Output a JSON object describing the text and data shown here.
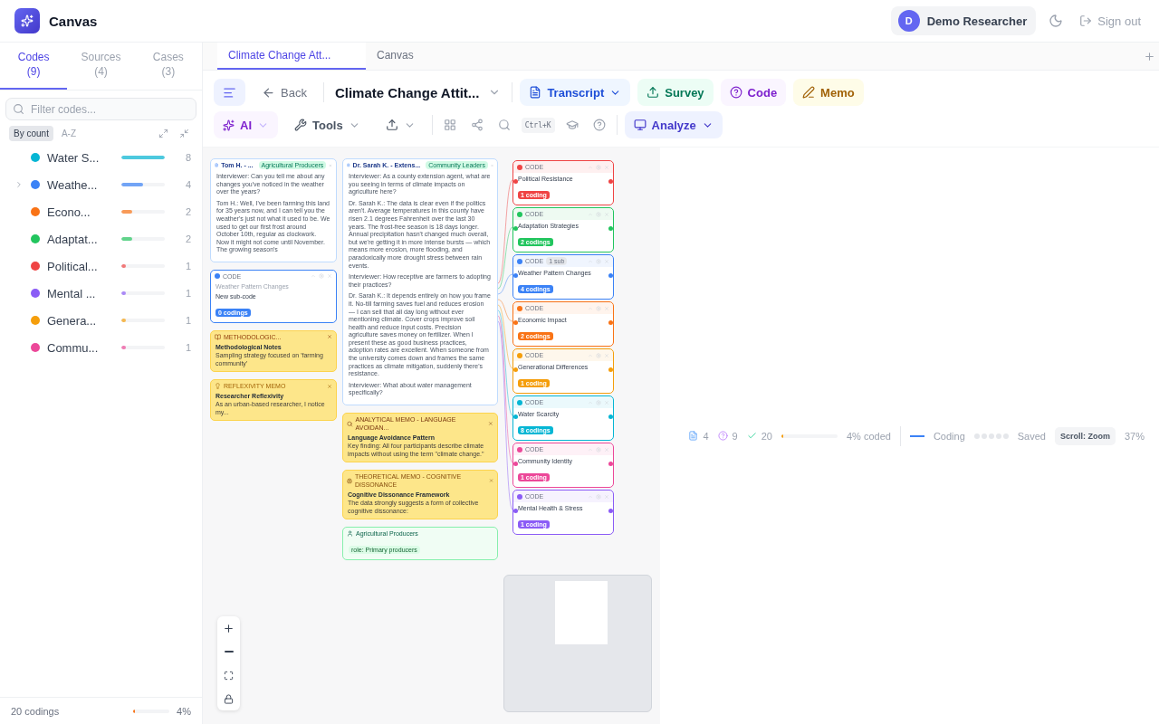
{
  "app": {
    "title": "Canvas"
  },
  "user": {
    "initial": "D",
    "name": "Demo Researcher"
  },
  "sign_out": "Sign out",
  "sidebar": {
    "tabs": [
      {
        "label": "Codes",
        "count": "(9)",
        "selected": true
      },
      {
        "label": "Sources",
        "count": "(4)",
        "selected": false
      },
      {
        "label": "Cases",
        "count": "(3)",
        "selected": false
      }
    ],
    "filter": {
      "placeholder": "Filter codes..."
    },
    "sort": [
      {
        "label": "By count",
        "selected": true
      },
      {
        "label": "A-Z",
        "selected": false
      }
    ],
    "codes": [
      {
        "name": "Water S...",
        "color": "#06b6d4",
        "level": 1,
        "count": "8",
        "expandable": false
      },
      {
        "name": "Weathe...",
        "color": "#3b82f6",
        "level": 0.5,
        "count": "4",
        "expandable": true
      },
      {
        "name": "Econo...",
        "color": "#f97316",
        "level": 0.25,
        "count": "2",
        "expandable": false
      },
      {
        "name": "Adaptat...",
        "color": "#22c55e",
        "level": 0.25,
        "count": "2",
        "expandable": false
      },
      {
        "name": "Political...",
        "color": "#ef4444",
        "level": 0.1,
        "count": "1",
        "expandable": false
      },
      {
        "name": "Mental ...",
        "color": "#8b5cf6",
        "level": 0.1,
        "count": "1",
        "expandable": false
      },
      {
        "name": "Genera...",
        "color": "#f59e0b",
        "level": 0.1,
        "count": "1",
        "expandable": false
      },
      {
        "name": "Commu...",
        "color": "#ec4899",
        "level": 0.1,
        "count": "1",
        "expandable": false
      }
    ],
    "footer": {
      "codings": "20 codings",
      "level": 0.04,
      "percent": "4%"
    }
  },
  "doc_tabs": [
    {
      "label": "Climate Change Att...",
      "selected": true
    },
    {
      "label": "Canvas",
      "selected": false
    }
  ],
  "toolbar": {
    "menu_selected": true,
    "back": "Back",
    "project": "Climate Change Attit...",
    "create": [
      {
        "label": "Transcript",
        "kind": "transcript"
      },
      {
        "label": "Survey",
        "kind": "survey"
      },
      {
        "label": "Code",
        "kind": "code"
      },
      {
        "label": "Memo",
        "kind": "memo"
      }
    ],
    "ai": "AI",
    "tools": "Tools",
    "shortcut": "Ctrl+K",
    "analyze": "Analyze"
  },
  "canvas": {
    "transcripts": [
      {
        "title": "Tom H. - ...",
        "tag": "Agricultural Producers",
        "paragraphs": [
          "Interviewer: Can you tell me about any changes you've noticed in the weather over the years?",
          "Tom H.: Well, I've been farming this land for 35 years now, and I can tell you the weather's just not what it used to be. We used to get our first frost around October 10th, regular as clockwork. Now it might not come until November. The growing season's"
        ]
      },
      {
        "title": "Dr. Sarah K. - Extens...",
        "tag": "Community Leaders",
        "paragraphs": [
          "Interviewer: As a county extension agent, what are you seeing in terms of climate impacts on agriculture here?",
          "Dr. Sarah K.: The data is clear even if the politics aren't. Average temperatures in this county have risen 2.1 degrees Fahrenheit over the last 30 years. The frost-free season is 18 days longer. Annual precipitation hasn't changed much overall, but we're getting it in more intense bursts — which means more erosion, more flooding, and paradoxically more drought stress between rain events.",
          "Interviewer: How receptive are farmers to adopting their practices?",
          "Dr. Sarah K.: It depends entirely on how you frame it. No-till farming saves fuel and reduces erosion — I can sell that all day long without ever mentioning climate. Cover crops improve soil health and reduce input costs. Precision agriculture saves money on fertilizer. When I present these as good business practices, adoption rates are excellent. When someone from the university comes down and frames the same practices as climate mitigation, suddenly there's resistance.",
          "Interviewer: What about water management specifically?"
        ]
      }
    ],
    "codes": [
      {
        "label": "CODE",
        "name": "Political Resistance",
        "badge": "1 coding",
        "color": "#ef4444"
      },
      {
        "label": "CODE",
        "name": "Adaptation Strategies",
        "badge": "2 codings",
        "color": "#22c55e"
      },
      {
        "label": "CODE",
        "name": "Weather Pattern Changes",
        "badge": "4 codings",
        "color": "#3b82f6",
        "sub": "1 sub"
      },
      {
        "label": "CODE",
        "name": "Economic Impact",
        "badge": "2 codings",
        "color": "#f97316"
      },
      {
        "label": "CODE",
        "name": "Generational Differences",
        "badge": "1 coding",
        "color": "#f59e0b"
      },
      {
        "label": "CODE",
        "name": "Water Scarcity",
        "badge": "8 codings",
        "color": "#06b6d4"
      },
      {
        "label": "CODE",
        "name": "Community Identity",
        "badge": "1 coding",
        "color": "#ec4899"
      },
      {
        "label": "CODE",
        "name": "Mental Health & Stress",
        "badge": "1 coding",
        "color": "#8b5cf6"
      }
    ],
    "subcode": {
      "label": "CODE",
      "parent": "Weather Pattern Changes",
      "name": "New sub-code",
      "badge": "0 codings"
    },
    "memos": [
      {
        "kind": "methodological",
        "header": "METHODOLOGIC...",
        "title": "Methodological Notes",
        "text": "Sampling strategy focused on 'farming community'"
      },
      {
        "kind": "reflexivity",
        "header": "REFLEXIVITY MEMO",
        "title": "Researcher Reflexivity",
        "text": "As an urban-based researcher, I notice my..."
      },
      {
        "kind": "analytical",
        "header": "ANALYTICAL MEMO - LANGUAGE AVOIDAN...",
        "title": "Language Avoidance Pattern",
        "text": "Key finding: All four participants describe climate impacts without using the term \"climate change.\""
      },
      {
        "kind": "theoretical",
        "header": "THEORETICAL MEMO - COGNITIVE DISSONANCE",
        "title": "Cognitive Dissonance Framework",
        "text": "The data strongly suggests a form of collective cognitive dissonance:"
      }
    ],
    "case": {
      "title": "Agricultural Producers",
      "attribute": "role: Primary producers"
    }
  },
  "status": {
    "sources": "4",
    "codes": "9",
    "codings": "20",
    "level": 0.04,
    "coded": "4% coded",
    "mode": "Coding",
    "saved": "Saved",
    "scroll": "Scroll: Zoom",
    "zoom": "37%"
  }
}
